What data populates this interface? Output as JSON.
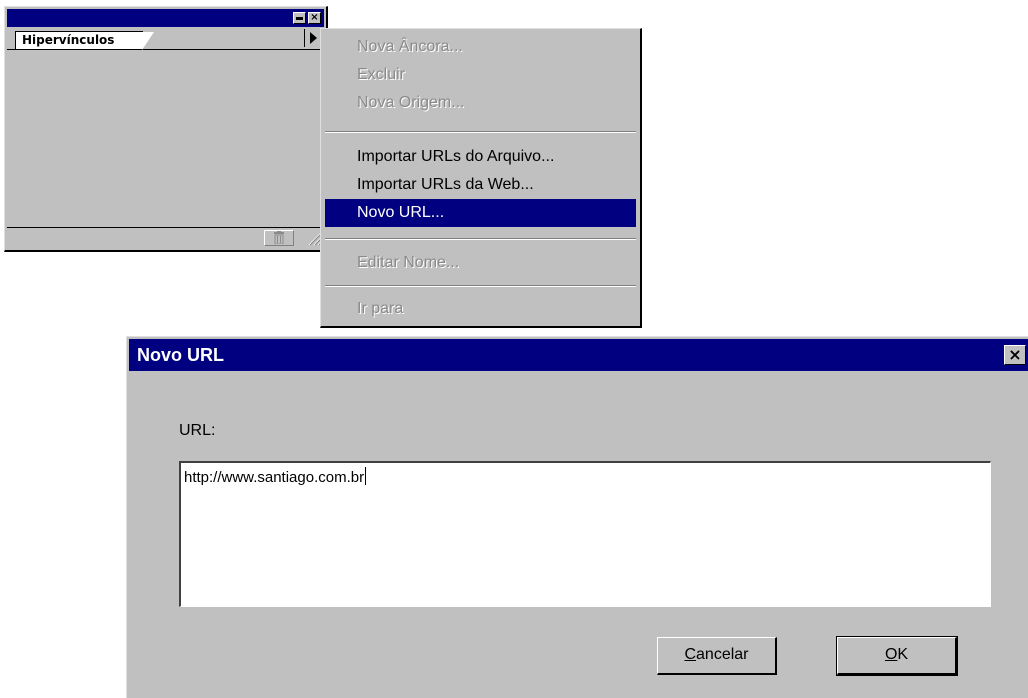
{
  "palette": {
    "tab_label": "Hipervínculos",
    "minimize_icon": "minimize-icon",
    "close_icon": "close-icon",
    "flyout_icon": "triangle-right-icon",
    "trash_icon": "trash-icon"
  },
  "menu": {
    "items": [
      {
        "label": "Nova Âncora...",
        "state": "disabled"
      },
      {
        "label": "Excluir",
        "state": "disabled"
      },
      {
        "label": "Nova Origem...",
        "state": "disabled"
      },
      {
        "label": "Importar URLs do Arquivo...",
        "state": "enabled"
      },
      {
        "label": "Importar URLs da Web...",
        "state": "enabled"
      },
      {
        "label": "Novo URL...",
        "state": "selected"
      },
      {
        "label": "Editar Nome...",
        "state": "disabled"
      },
      {
        "label": "Ir para",
        "state": "disabled"
      }
    ]
  },
  "dialog": {
    "title": "Novo URL",
    "close_glyph": "×",
    "url_label": "URL:",
    "url_value": "http://www.santiago.com.br",
    "cancel_mnemonic": "C",
    "cancel_rest": "ancelar",
    "ok_mnemonic": "O",
    "ok_rest": "K"
  },
  "colors": {
    "titlebar": "#000080",
    "face": "#c0c0c0",
    "highlight": "#000080"
  }
}
